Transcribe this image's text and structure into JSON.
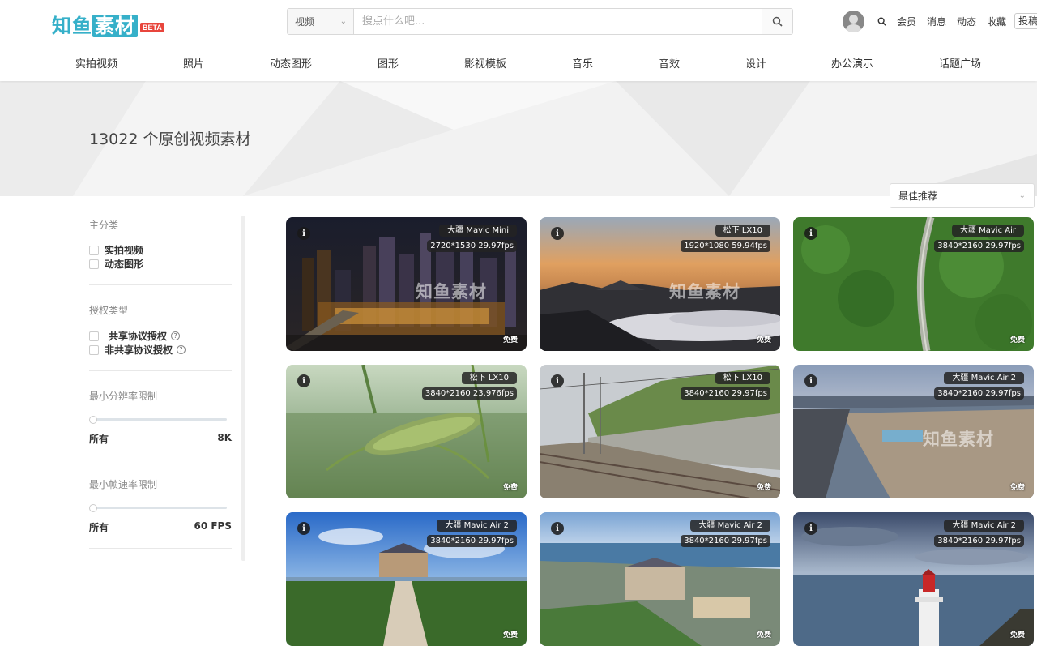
{
  "logo": {
    "part1": "知鱼",
    "part2": "素材",
    "beta": "BETA"
  },
  "search": {
    "category": "视频",
    "placeholder": "搜点什么吧..."
  },
  "user_links": [
    "会员",
    "消息",
    "动态",
    "收藏"
  ],
  "contribute": "投稿",
  "nav": [
    "实拍视频",
    "照片",
    "动态图形",
    "图形",
    "影视模板",
    "音乐",
    "音效",
    "设计",
    "办公演示",
    "话题广场"
  ],
  "banner": {
    "title": "13022 个原创视频素材"
  },
  "sort": {
    "selected": "最佳推荐"
  },
  "sidebar": {
    "main_category": {
      "title": "主分类",
      "options": [
        "实拍视频",
        "动态图形"
      ]
    },
    "license": {
      "title": "授权类型",
      "options": [
        "共享协议授权",
        "非共享协议授权"
      ]
    },
    "resolution": {
      "title": "最小分辨率限制",
      "min": "所有",
      "max": "8K"
    },
    "framerate": {
      "title": "最小帧速率限制",
      "min": "所有",
      "max": "60 FPS"
    }
  },
  "watermark_text": "知鱼素材",
  "cards": [
    {
      "camera": "大疆 Mavic Mini",
      "spec": "2720*1530 29.97fps",
      "badge": "免费",
      "scene": "city-night"
    },
    {
      "camera": "松下 LX10",
      "spec": "1920*1080 59.94fps",
      "badge": "免费",
      "scene": "sunset-clouds"
    },
    {
      "camera": "大疆 Mavic Air",
      "spec": "3840*2160 29.97fps",
      "badge": "免费",
      "scene": "forest-road"
    },
    {
      "camera": "松下 LX10",
      "spec": "3840*2160 23.976fps",
      "badge": "免费",
      "scene": "grass-closeup"
    },
    {
      "camera": "松下 LX10",
      "spec": "3840*2160 29.97fps",
      "badge": "免费",
      "scene": "railway"
    },
    {
      "camera": "大疆 Mavic Air 2",
      "spec": "3840*2160 29.97fps",
      "badge": "免费",
      "scene": "beach"
    },
    {
      "camera": "大疆 Mavic Air 2",
      "spec": "3840*2160 29.97fps",
      "badge": "免费",
      "scene": "castle-path"
    },
    {
      "camera": "大疆 Mavic Air 2",
      "spec": "3840*2160 29.97fps",
      "badge": "免费",
      "scene": "castle-coast"
    },
    {
      "camera": "大疆 Mavic Air 2",
      "spec": "3840*2160 29.97fps",
      "badge": "免费",
      "scene": "lighthouse"
    }
  ],
  "colors": {
    "brand": "#36b0c9",
    "beta": "#e8453c"
  }
}
